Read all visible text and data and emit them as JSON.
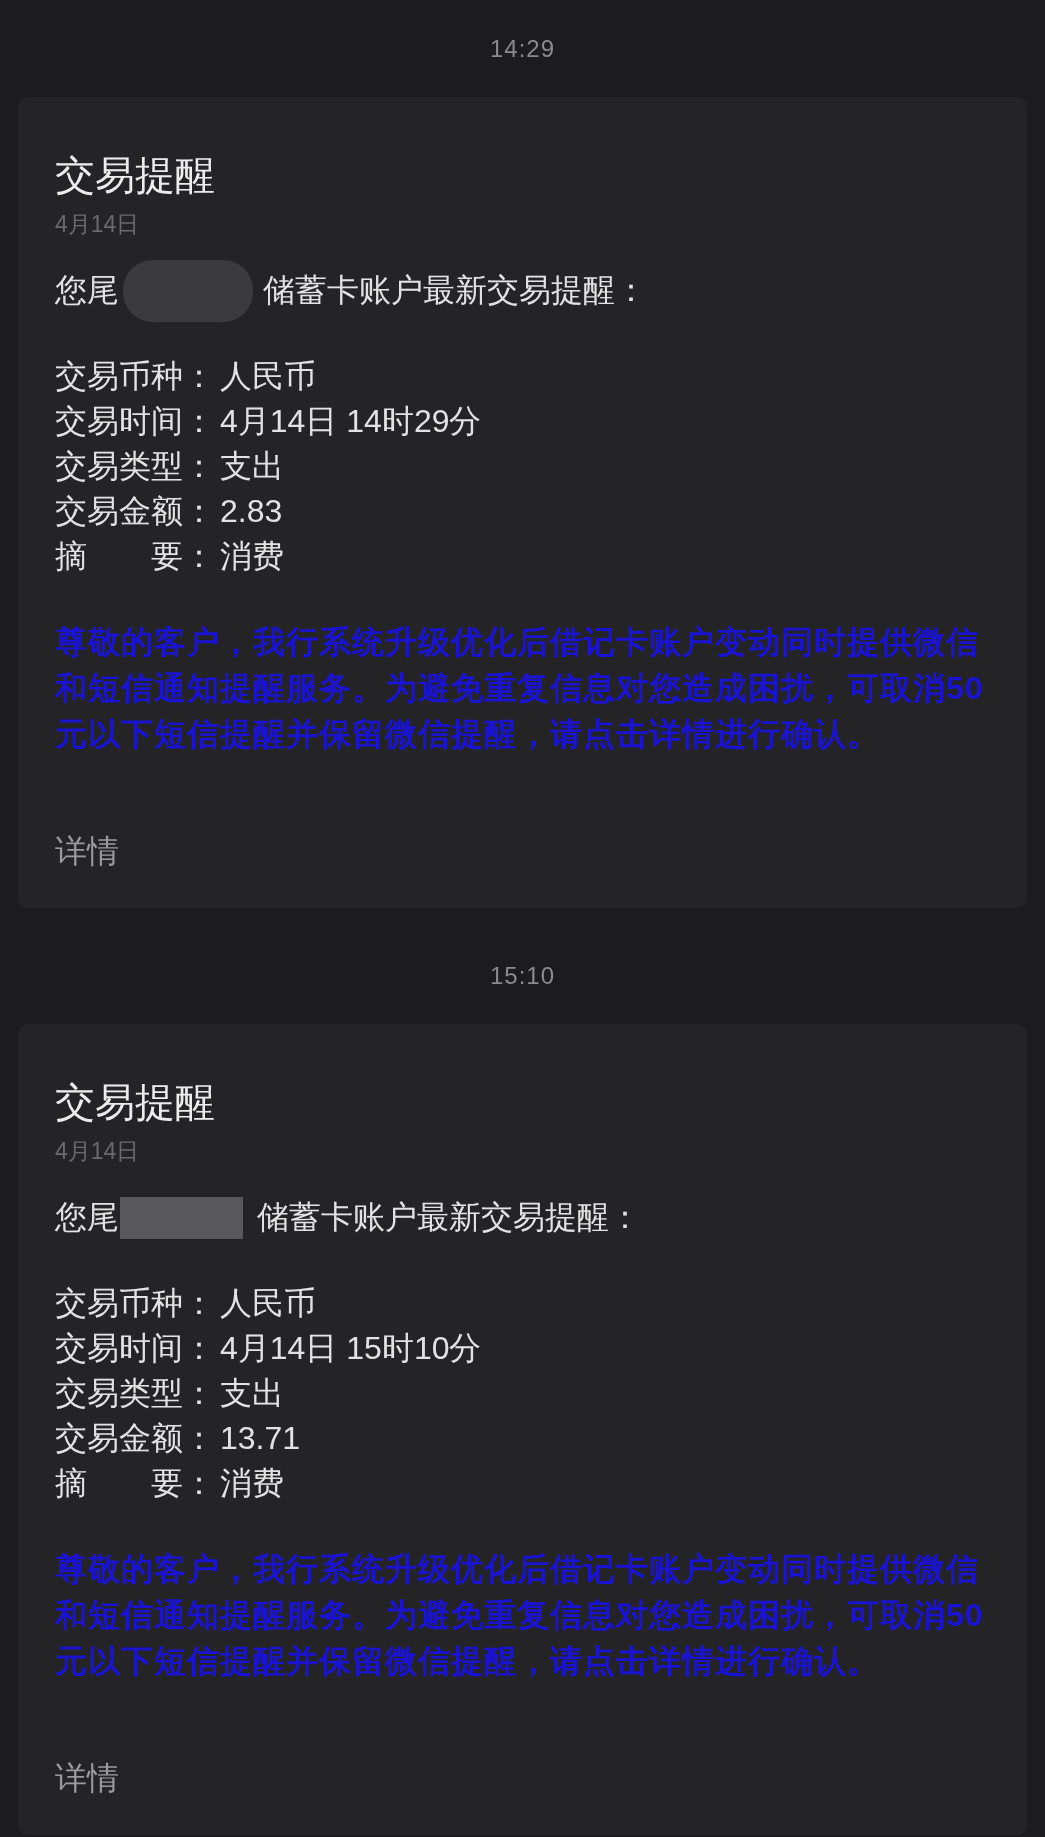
{
  "messages": [
    {
      "time": "14:29",
      "card": {
        "title": "交易提醒",
        "date": "4月14日",
        "intro_start": "您尾",
        "redaction": {
          "kind": "blur"
        },
        "intro_end": "储蓄卡账户最新交易提醒：",
        "details": [
          {
            "label": "交易币种：",
            "value": "人民币"
          },
          {
            "label": "交易时间：",
            "value": "4月14日 14时29分"
          },
          {
            "label": "交易类型：",
            "value": "支出"
          },
          {
            "label": "交易金额：",
            "value": "2.83"
          },
          {
            "label": "摘　　要：",
            "value": "消费"
          }
        ],
        "notice": "尊敬的客户，我行系统升级优化后借记卡账户变动同时提供微信和短信通知提醒服务。为避免重复信息对您造成困扰，可取消50元以下短信提醒并保留微信提醒，请点击详情进行确认。",
        "link": "详情"
      }
    },
    {
      "time": "15:10",
      "card": {
        "title": "交易提醒",
        "date": "4月14日",
        "intro_start": "您尾",
        "redaction": {
          "kind": "mosaic"
        },
        "intro_end": "储蓄卡账户最新交易提醒：",
        "details": [
          {
            "label": "交易币种：",
            "value": "人民币"
          },
          {
            "label": "交易时间：",
            "value": "4月14日 15时10分"
          },
          {
            "label": "交易类型：",
            "value": "支出"
          },
          {
            "label": "交易金额：",
            "value": "13.71"
          },
          {
            "label": "摘　　要：",
            "value": "消费"
          }
        ],
        "notice": "尊敬的客户，我行系统升级优化后借记卡账户变动同时提供微信和短信通知提醒服务。为避免重复信息对您造成困扰，可取消50元以下短信提醒并保留微信提醒，请点击详情进行确认。",
        "link": "详情"
      }
    }
  ]
}
